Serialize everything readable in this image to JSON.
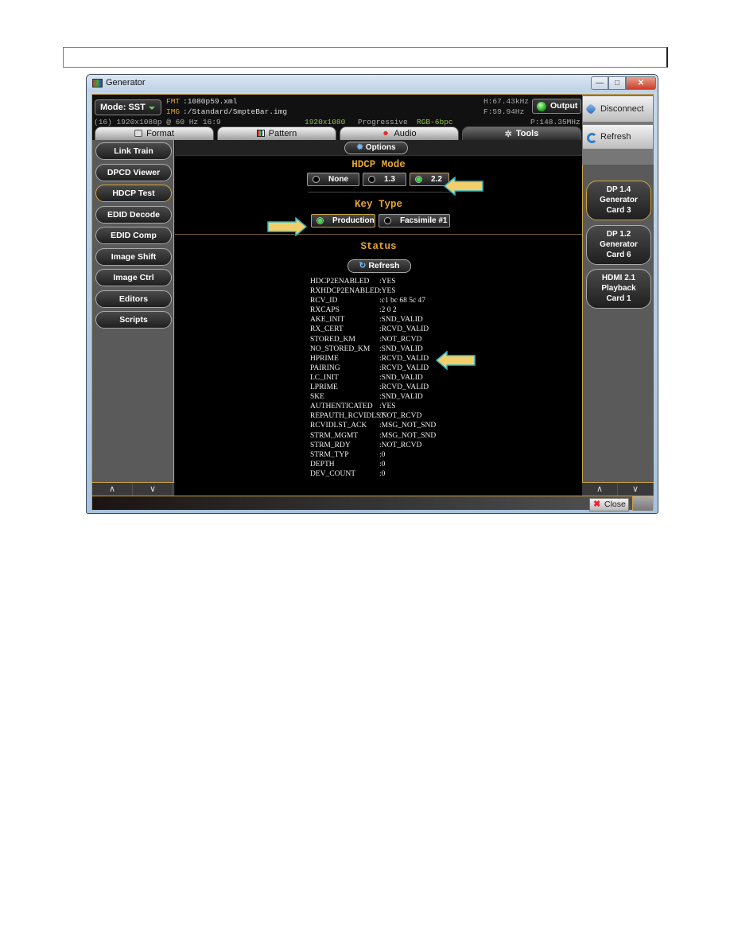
{
  "window": {
    "title": "Generator",
    "controls": {
      "minimize": "—",
      "maximize": "□",
      "close": "✕"
    }
  },
  "info": {
    "mode_label": "Mode: SST",
    "fmt_label": "FMT",
    "fmt_value": ":1080p59.xml",
    "img_label": "IMG",
    "img_value": ":/Standard/SmpteBar.img",
    "timing": "(16) 1920x1080p @ 60 Hz 16:9",
    "resolution": "1920x1080",
    "scan": "Progressive",
    "color": "RGB-6bpc",
    "h_freq": "H:67.43kHz",
    "f_freq": "F:59.94Hz",
    "p_clock": "P:148.35MHz",
    "output_label": "Output",
    "output_status_color": "#2fb52f"
  },
  "top_right": {
    "disconnect_label": "Disconnect",
    "refresh_label": "Refresh"
  },
  "tabs": [
    {
      "label": "Format",
      "icon": "monitor-icon",
      "active": false
    },
    {
      "label": "Pattern",
      "icon": "color-bars-icon",
      "active": false
    },
    {
      "label": "Audio",
      "icon": "speaker-icon",
      "active": false
    },
    {
      "label": "Tools",
      "icon": "tools-icon",
      "active": true
    }
  ],
  "left_nav": {
    "items": [
      {
        "label": "Link Train",
        "active": false
      },
      {
        "label": "DPCD Viewer",
        "active": false
      },
      {
        "label": "HDCP Test",
        "active": true
      },
      {
        "label": "EDID Decode",
        "active": false
      },
      {
        "label": "EDID Comp",
        "active": false
      },
      {
        "label": "Image Shift",
        "active": false
      },
      {
        "label": "Image Ctrl",
        "active": false
      },
      {
        "label": "Editors",
        "active": false
      },
      {
        "label": "Scripts",
        "active": false
      }
    ],
    "scroll_up": "∧",
    "scroll_down": "∨"
  },
  "main": {
    "options_label": "Options",
    "hdcp_mode": {
      "title": "HDCP Mode",
      "options": [
        "None",
        "1.3",
        "2.2"
      ],
      "selected": "2.2"
    },
    "key_type": {
      "title": "Key Type",
      "options": [
        "Production",
        "Facsimile #1"
      ],
      "selected": "Production"
    },
    "status": {
      "title": "Status",
      "refresh_label": "Refresh",
      "rows": [
        {
          "key": "HDCP2ENABLED",
          "value": ":YES"
        },
        {
          "key": "RXHDCP2ENABLED",
          "value": ":YES"
        },
        {
          "key": "RCV_ID",
          "value": ":c1 bc 68 5c 47"
        },
        {
          "key": "RXCAPS",
          "value": ":2 0 2"
        },
        {
          "key": "AKE_INIT",
          "value": ":SND_VALID"
        },
        {
          "key": "RX_CERT",
          "value": ":RCVD_VALID"
        },
        {
          "key": "STORED_KM",
          "value": ":NOT_RCVD"
        },
        {
          "key": "NO_STORED_KM",
          "value": ":SND_VALID"
        },
        {
          "key": "HPRIME",
          "value": ":RCVD_VALID"
        },
        {
          "key": "PAIRING",
          "value": ":RCVD_VALID"
        },
        {
          "key": "LC_INIT",
          "value": ":SND_VALID"
        },
        {
          "key": "LPRIME",
          "value": ":RCVD_VALID"
        },
        {
          "key": "SKE",
          "value": ":SND_VALID"
        },
        {
          "key": "AUTHENTICATED",
          "value": ":YES"
        },
        {
          "key": "REPAUTH_RCVIDLST",
          "value": ":NOT_RCVD"
        },
        {
          "key": "RCVIDLST_ACK",
          "value": ":MSG_NOT_SND"
        },
        {
          "key": "STRM_MGMT",
          "value": ":MSG_NOT_SND"
        },
        {
          "key": "STRM_RDY",
          "value": ":NOT_RCVD"
        },
        {
          "key": "STRM_TYP",
          "value": ":0"
        },
        {
          "key": "DEPTH",
          "value": ":0"
        },
        {
          "key": "DEV_COUNT",
          "value": ":0"
        }
      ]
    }
  },
  "right_cards": {
    "items": [
      {
        "lines": [
          "DP 1.4",
          "Generator",
          "Card 3"
        ],
        "active": true
      },
      {
        "lines": [
          "DP 1.2",
          "Generator",
          "Card 6"
        ],
        "active": false
      },
      {
        "lines": [
          "HDMI 2.1",
          "Playback",
          "Card 1"
        ],
        "active": false
      }
    ],
    "scroll_up": "∧",
    "scroll_down": "∨"
  },
  "bottom": {
    "close_label": "Close"
  },
  "annotation_color": "#f2cf6a"
}
